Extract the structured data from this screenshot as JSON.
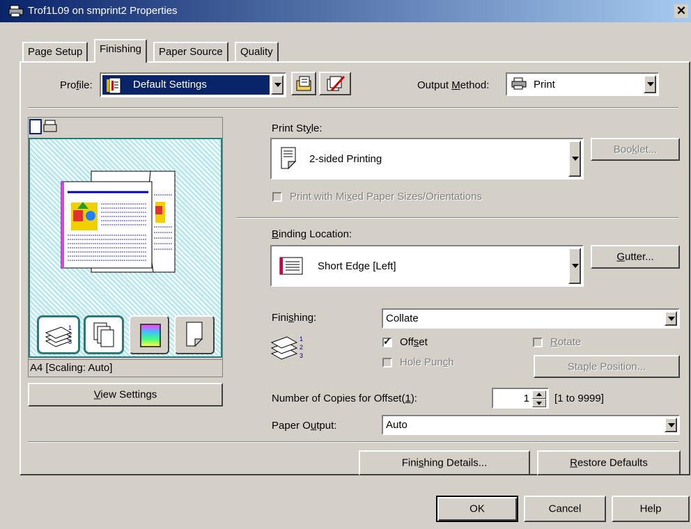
{
  "window": {
    "title": "Trof1L09 on smprint2 Properties",
    "close": "✕"
  },
  "tabs": [
    "Page Setup",
    "Finishing",
    "Paper Source",
    "Quality"
  ],
  "profile": {
    "label": "Profile:",
    "value": "Default Settings"
  },
  "output_method": {
    "label": "Output Method:",
    "value": "Print"
  },
  "preview": {
    "status": "A4 [Scaling: Auto]",
    "view_settings": "View Settings"
  },
  "print_style": {
    "label": "Print Style:",
    "value": "2-sided Printing",
    "booklet": "Booklet...",
    "mixed": "Print with Mixed Paper Sizes/Orientations"
  },
  "binding": {
    "label": "Binding Location:",
    "value": "Short Edge [Left]",
    "gutter": "Gutter..."
  },
  "finishing": {
    "label": "Finishing:",
    "value": "Collate",
    "offset": "Offset",
    "rotate": "Rotate",
    "hole_punch": "Hole Punch",
    "staple_position": "Staple Position..."
  },
  "copies": {
    "label": "Number of Copies for Offset(1):",
    "value": "1",
    "range": "[1 to 9999]"
  },
  "paper_output": {
    "label": "Paper Output:",
    "value": "Auto"
  },
  "buttons": {
    "finishing_details": "Finishing Details...",
    "restore_defaults": "Restore Defaults",
    "ok": "OK",
    "cancel": "Cancel",
    "help": "Help"
  },
  "colors": {
    "title_start": "#0a246a",
    "title_end": "#a6caf0",
    "face": "#d4d0c8",
    "selected": "#0a246a",
    "preview_bg": "#b8e8f0",
    "preview_border": "#2a7a7a"
  }
}
